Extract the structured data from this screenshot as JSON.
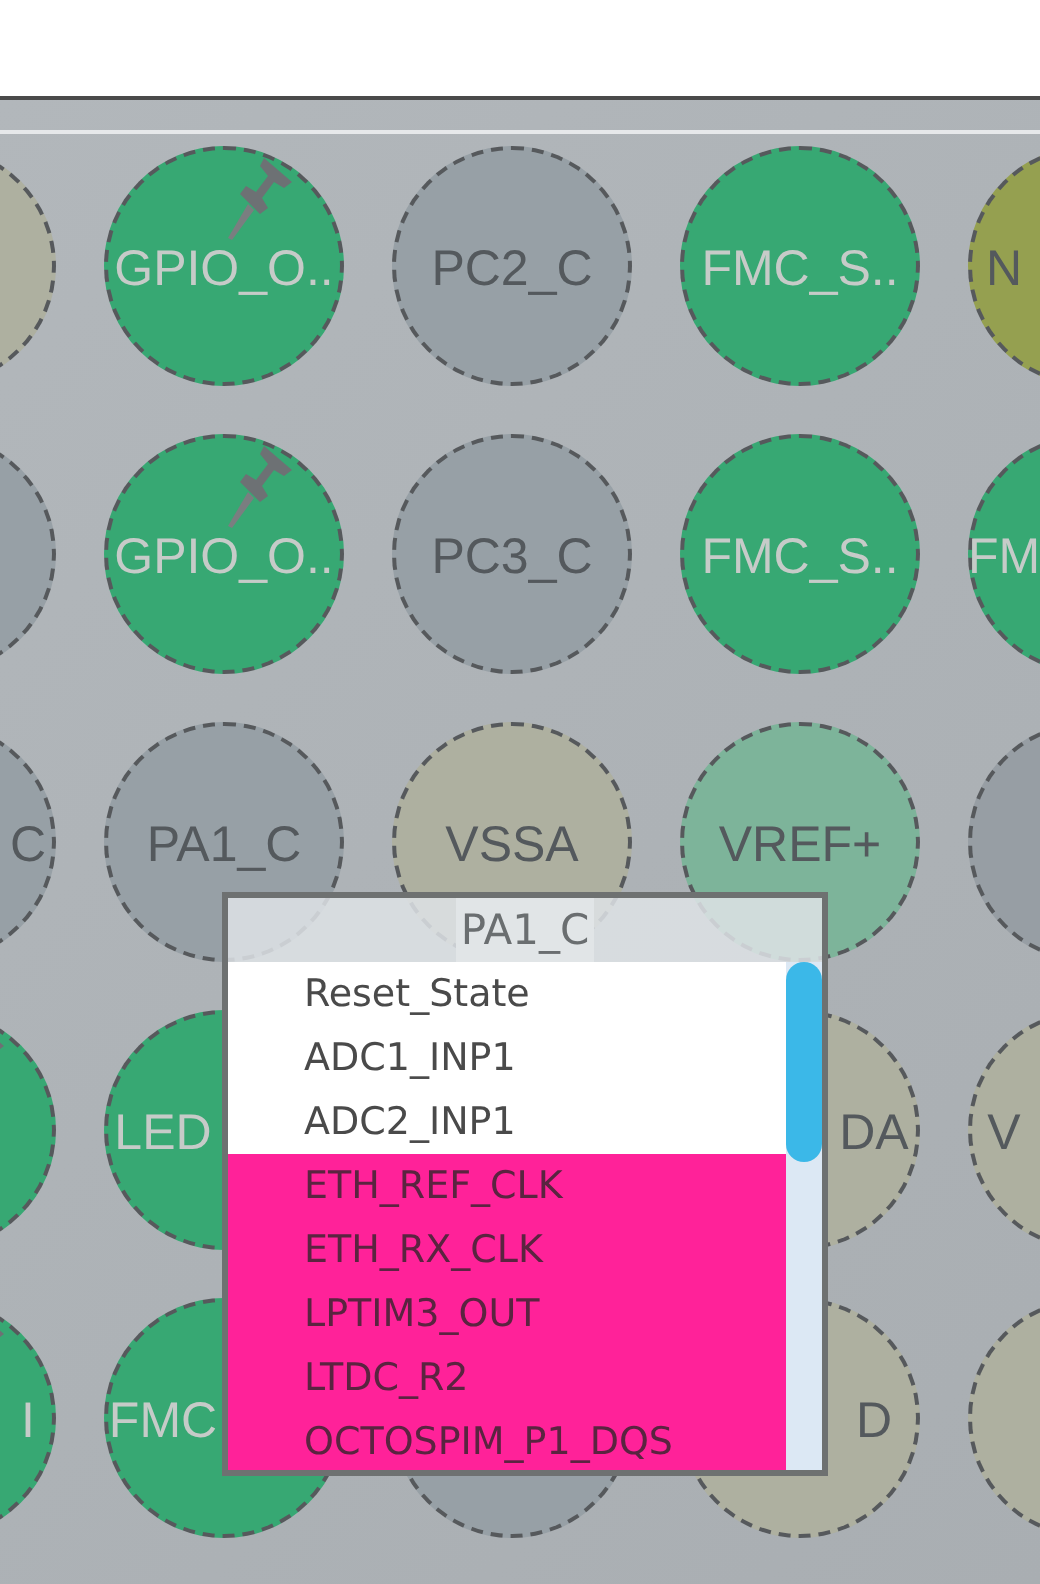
{
  "pinout": {
    "rows": [
      {
        "balls": [
          {
            "color": "#aeb0a0",
            "kind": "pad"
          },
          {
            "label": "GPIO_O..",
            "color": "#37a873",
            "kind": "signal",
            "pinned": true
          },
          {
            "label": "PC2_C",
            "color": "#97a0a6",
            "kind": "pad"
          },
          {
            "label": "FMC_S..",
            "color": "#37a873",
            "kind": "signal"
          },
          {
            "label": "N",
            "color": "#95a050",
            "kind": "pad"
          }
        ]
      },
      {
        "balls": [
          {
            "color": "#97a0a6",
            "kind": "pad"
          },
          {
            "label": "GPIO_O..",
            "color": "#37a873",
            "kind": "signal",
            "pinned": true
          },
          {
            "label": "PC3_C",
            "color": "#97a0a6",
            "kind": "pad"
          },
          {
            "label": "FMC_S..",
            "color": "#37a873",
            "kind": "signal"
          },
          {
            "label": "FM",
            "color": "#37a873",
            "kind": "signal"
          }
        ]
      },
      {
        "balls": [
          {
            "label": "C",
            "color": "#97a0a6",
            "kind": "pad"
          },
          {
            "label": "PA1_C",
            "color": "#97a0a6",
            "kind": "pad"
          },
          {
            "label": "VSSA",
            "color": "#aeb0a0",
            "kind": "pad"
          },
          {
            "label": "VREF+",
            "color": "#7db49a",
            "kind": "pad"
          },
          {
            "color": "#979ea4",
            "kind": "pad"
          }
        ]
      },
      {
        "balls": [
          {
            "color": "#37a873",
            "kind": "signal",
            "pinned": true
          },
          {
            "label": "LED",
            "color": "#37a873",
            "kind": "signal"
          }
        ],
        "balls_right_of_popup": [
          {
            "label": "DA",
            "color": "#aeb0a0",
            "kind": "pad"
          },
          {
            "label": "V",
            "color": "#aeb0a0",
            "kind": "pad"
          }
        ]
      },
      {
        "balls": [
          {
            "label": "I",
            "color": "#37a873",
            "kind": "signal",
            "pinned": true
          },
          {
            "label": "FMC",
            "color": "#37a873",
            "kind": "signal"
          },
          {
            "color": "#97a0a6",
            "kind": "pad"
          },
          {
            "label": "D",
            "color": "#aeb0a0",
            "kind": "pad"
          },
          {
            "color": "#aeb0a0",
            "kind": "pad"
          }
        ]
      }
    ]
  },
  "popup": {
    "title": "PA1_C",
    "items": [
      {
        "label": "Reset_State",
        "color": "#ffffff"
      },
      {
        "label": "ADC1_INP1",
        "color": "#ffffff"
      },
      {
        "label": "ADC2_INP1",
        "color": "#ffffff"
      },
      {
        "label": "ETH_REF_CLK",
        "color": "#ff2299"
      },
      {
        "label": "ETH_RX_CLK",
        "color": "#ff2299"
      },
      {
        "label": "LPTIM3_OUT",
        "color": "#ff2299"
      },
      {
        "label": "LTDC_R2",
        "color": "#ff2299"
      },
      {
        "label": "OCTOSPIM_P1_DQS",
        "color": "#ff2299"
      }
    ]
  }
}
